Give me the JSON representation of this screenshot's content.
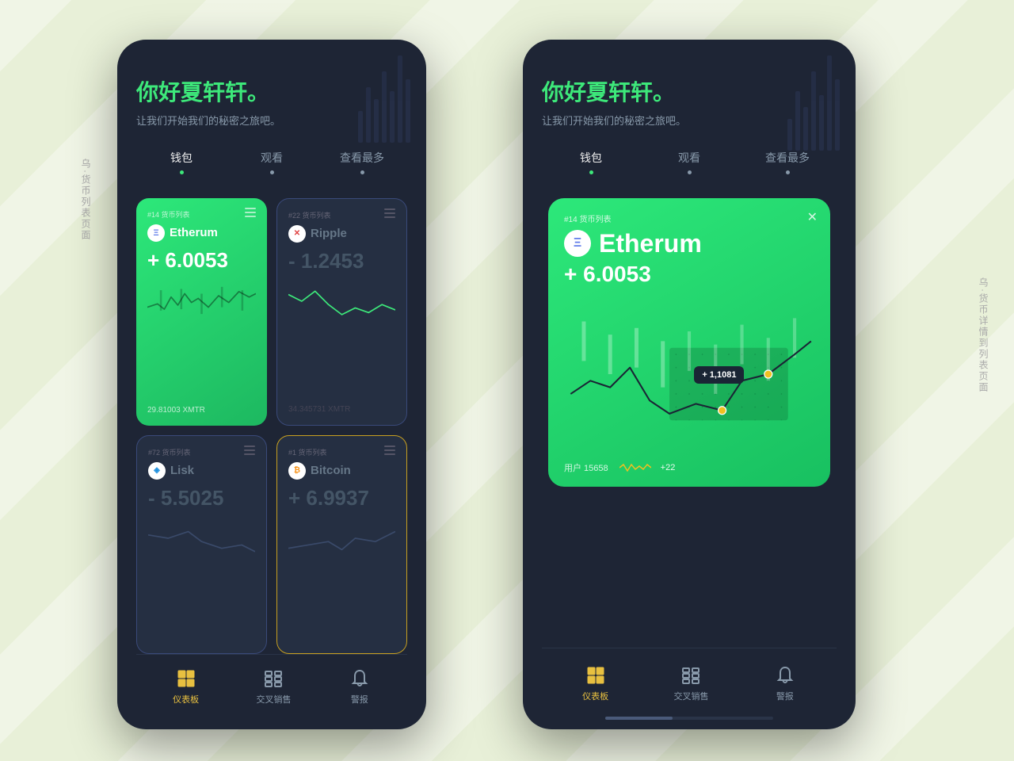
{
  "background": {
    "color": "#e8f0d8"
  },
  "rotated_labels": {
    "left": "乌·货币列表页面",
    "right": "乌·货币详情到列表页面"
  },
  "greeting": {
    "title": "你好夏轩轩。",
    "subtitle": "让我们开始我们的秘密之旅吧。"
  },
  "tabs": [
    {
      "label": "钱包",
      "active": true
    },
    {
      "label": "观看",
      "active": false
    },
    {
      "label": "查看最多",
      "active": false
    }
  ],
  "cards": [
    {
      "id": "etherum",
      "tag": "#14 货币列表",
      "coin_icon": "Ξ",
      "coin_icon_type": "eth",
      "name": "Etherum",
      "value": "+ 6.0053",
      "xmtr": "29.81003 XMTR",
      "type": "green",
      "chart_positive": true
    },
    {
      "id": "ripple",
      "tag": "#22 货币列表",
      "coin_icon": "✕",
      "coin_icon_type": "xrp",
      "name": "Ripple",
      "value": "- 1.2453",
      "xmtr": "34.345731 XMTR",
      "type": "dark",
      "chart_positive": false
    },
    {
      "id": "lisk",
      "tag": "#72 货币列表",
      "coin_icon": "⬡",
      "coin_icon_type": "lsk",
      "name": "Lisk",
      "value": "- 5.5025",
      "xmtr": "",
      "type": "dark",
      "chart_positive": false
    },
    {
      "id": "bitcoin",
      "tag": "#1 货币列表",
      "coin_icon": "₿",
      "coin_icon_type": "btc",
      "name": "Bitcoin",
      "value": "+ 6.9937",
      "xmtr": "",
      "type": "dark-yellow",
      "chart_positive": true
    }
  ],
  "nav": {
    "items": [
      {
        "label": "仪表板",
        "icon": "dashboard",
        "active": true
      },
      {
        "label": "交叉销售",
        "icon": "cross-sell",
        "active": false
      },
      {
        "label": "警报",
        "icon": "bell",
        "active": false
      }
    ]
  },
  "detail": {
    "tag": "#14 货币列表",
    "coin_icon": "Ξ",
    "name": "Etherum",
    "value": "+ 6.0053",
    "tooltip": "+ 1,1081",
    "users_label": "用户 15658",
    "users_change": "+22",
    "close": "✕"
  }
}
